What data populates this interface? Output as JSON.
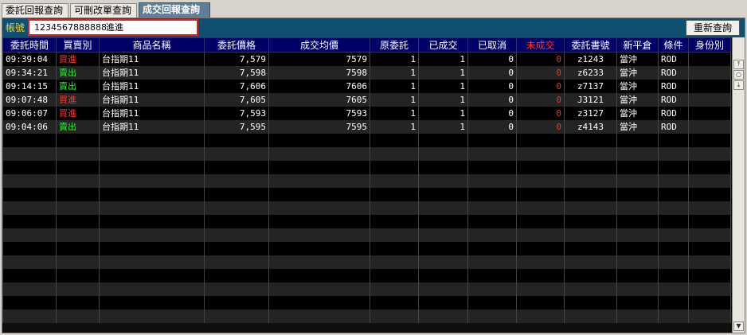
{
  "tabs": [
    {
      "label": "委託回報查詢"
    },
    {
      "label": "可刪改單查詢"
    },
    {
      "label": "成交回報查詢"
    }
  ],
  "toolbar": {
    "account_label": "帳號",
    "account_number": "1234567888888",
    "account_name": "進進",
    "refresh_label": "重新查詢"
  },
  "columns": [
    "委託時間",
    "買賣別",
    "商品名稱",
    "委託價格",
    "成交均價",
    "原委託",
    "已成交",
    "已取消",
    "未成交",
    "委託書號",
    "新平倉",
    "條件",
    "身份別"
  ],
  "rows": [
    {
      "time": "09:39:04",
      "side": "買進",
      "product": "台指期11",
      "price": "7,579",
      "avg": "7579",
      "orig": "1",
      "filled": "1",
      "cancelled": "0",
      "unfilled": "0",
      "order_no": "z1243",
      "open_close": "當沖",
      "cond": "ROD",
      "identity": ""
    },
    {
      "time": "09:34:21",
      "side": "賣出",
      "product": "台指期11",
      "price": "7,598",
      "avg": "7598",
      "orig": "1",
      "filled": "1",
      "cancelled": "0",
      "unfilled": "0",
      "order_no": "z6233",
      "open_close": "當沖",
      "cond": "ROD",
      "identity": ""
    },
    {
      "time": "09:14:15",
      "side": "賣出",
      "product": "台指期11",
      "price": "7,606",
      "avg": "7606",
      "orig": "1",
      "filled": "1",
      "cancelled": "0",
      "unfilled": "0",
      "order_no": "z7137",
      "open_close": "當沖",
      "cond": "ROD",
      "identity": ""
    },
    {
      "time": "09:07:48",
      "side": "買進",
      "product": "台指期11",
      "price": "7,605",
      "avg": "7605",
      "orig": "1",
      "filled": "1",
      "cancelled": "0",
      "unfilled": "0",
      "order_no": "J3121",
      "open_close": "當沖",
      "cond": "ROD",
      "identity": ""
    },
    {
      "time": "09:06:07",
      "side": "買進",
      "product": "台指期11",
      "price": "7,593",
      "avg": "7593",
      "orig": "1",
      "filled": "1",
      "cancelled": "0",
      "unfilled": "0",
      "order_no": "z3127",
      "open_close": "當沖",
      "cond": "ROD",
      "identity": ""
    },
    {
      "time": "09:04:06",
      "side": "賣出",
      "product": "台指期11",
      "price": "7,595",
      "avg": "7595",
      "orig": "1",
      "filled": "1",
      "cancelled": "0",
      "unfilled": "0",
      "order_no": "z4143",
      "open_close": "當沖",
      "cond": "ROD",
      "identity": ""
    }
  ],
  "colors": {
    "header_bg": "#000066",
    "toolbar_bg": "#0f4f6f",
    "buy": "#ff3333",
    "sell": "#33ee33",
    "label_yellow": "#ffd21e"
  },
  "scrollbar": {
    "top_icon": "scroll-to-top-icon",
    "center_icon": "scroll-center-icon",
    "bottom_icon": "scroll-to-bottom-icon",
    "down_icon": "scroll-down-arrow-icon"
  }
}
